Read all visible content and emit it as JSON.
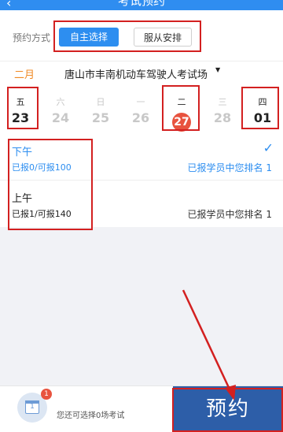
{
  "header": {
    "title": "考试预约",
    "back_icon": "chevron-left-icon"
  },
  "mode": {
    "label": "预约方式",
    "primary": "自主选择",
    "secondary": "服从安排"
  },
  "location": {
    "month": "二月",
    "venue": "唐山市丰南机动车驾驶人考试场"
  },
  "dates": [
    {
      "weekday": "五",
      "day": "23",
      "state": "active"
    },
    {
      "weekday": "六",
      "day": "24",
      "state": "dim"
    },
    {
      "weekday": "日",
      "day": "25",
      "state": "dim"
    },
    {
      "weekday": "一",
      "day": "26",
      "state": "dim"
    },
    {
      "weekday": "二",
      "day": "27",
      "state": "selected"
    },
    {
      "weekday": "三",
      "day": "28",
      "state": "dim"
    },
    {
      "weekday": "四",
      "day": "01",
      "state": "active"
    }
  ],
  "slots": [
    {
      "name": "下午",
      "quota": "已报0/可报100",
      "rank": "已报学员中您排名 1",
      "selected": true
    },
    {
      "name": "上午",
      "quota": "已报1/可报140",
      "rank": "已报学员中您排名 1",
      "selected": false
    }
  ],
  "footer": {
    "badge": "1",
    "remaining": "您还可选择0场考试",
    "book_button": "预约",
    "calendar_day": "1"
  },
  "colors": {
    "primary": "#2d8ef0",
    "accent": "#e8533f",
    "book": "#2d5ea8",
    "highlight": "#d32020"
  }
}
